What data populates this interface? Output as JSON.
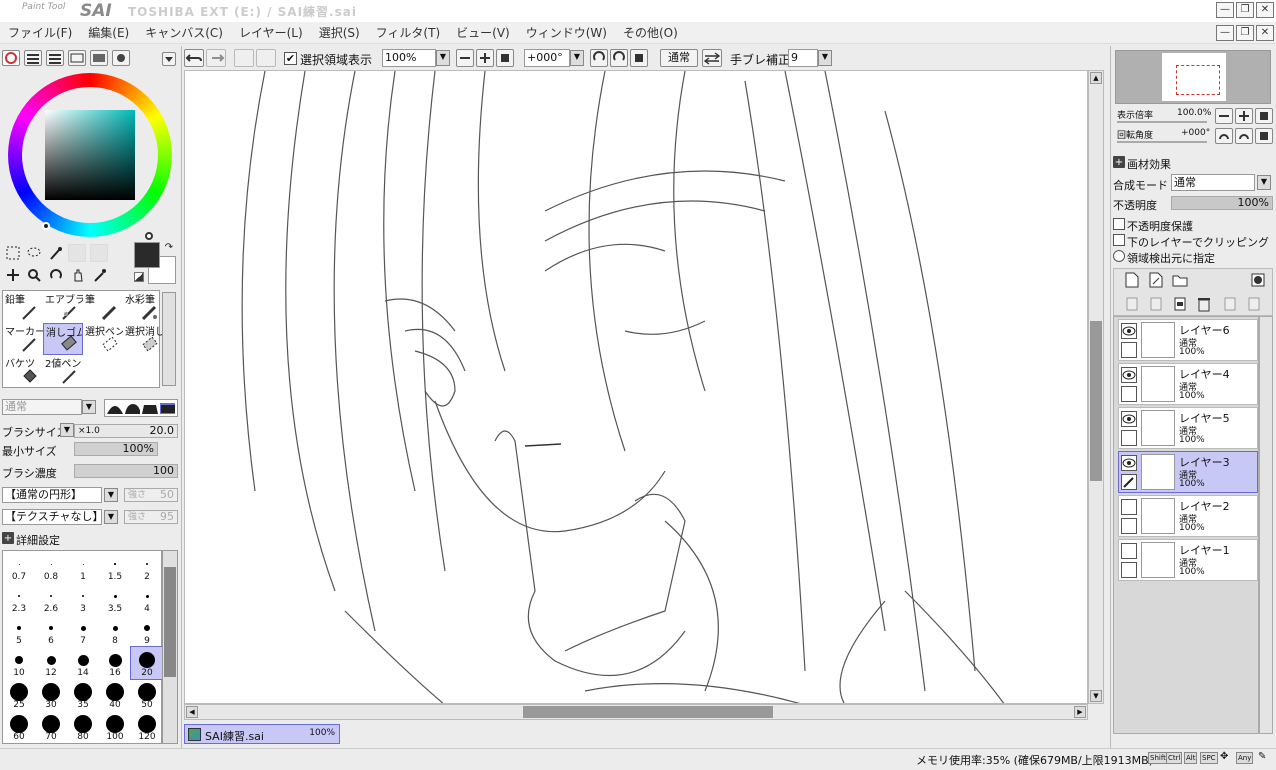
{
  "titlebar": {
    "app": "Paint Tool",
    "logo": "SAI",
    "title": "TOSHIBA EXT (E:) / SAI練習.sai",
    "btn_min": "—",
    "btn_max": "❐",
    "btn_close": "✕"
  },
  "menu": [
    "ファイル(F)",
    "編集(E)",
    "キャンバス(C)",
    "レイヤー(L)",
    "選択(S)",
    "フィルタ(T)",
    "ビュー(V)",
    "ウィンドウ(W)",
    "その他(O)"
  ],
  "toolbar": {
    "show_selection": "選択領域表示",
    "zoom": "100%",
    "angle": "+000°",
    "blend": "通常",
    "stabilizer_label": "手ブレ補正",
    "stabilizer": "9"
  },
  "tools": [
    {
      "name": "鉛筆"
    },
    {
      "name": "エアブラシ"
    },
    {
      "name": "筆"
    },
    {
      "name": "水彩筆"
    },
    {
      "name": "マーカー"
    },
    {
      "name": "消しゴム"
    },
    {
      "name": "選択ペン"
    },
    {
      "name": "選択消し"
    },
    {
      "name": "バケツ"
    },
    {
      "name": "2値ペン"
    }
  ],
  "brush": {
    "mode": "通常",
    "size_label": "ブラシサイズ",
    "size_mult": "×1.0",
    "size": "20.0",
    "min_label": "最小サイズ",
    "min": "100%",
    "density_label": "ブラシ濃度",
    "density": "100",
    "shape": "【通常の円形】",
    "shape_strength_label": "強さ",
    "shape_strength": "50",
    "texture": "【テクスチャなし】",
    "texture_strength_label": "強さ",
    "texture_strength": "95",
    "advanced": "詳細設定"
  },
  "sizes": [
    "0.7",
    "0.8",
    "1",
    "1.5",
    "2",
    "2.3",
    "2.6",
    "3",
    "3.5",
    "4",
    "5",
    "6",
    "7",
    "8",
    "9",
    "10",
    "12",
    "14",
    "16",
    "20",
    "25",
    "30",
    "35",
    "40",
    "50",
    "60",
    "70",
    "80",
    "100",
    "120"
  ],
  "navigator": {
    "zoom_label": "表示倍率",
    "zoom": "100.0%",
    "rot_label": "回転角度",
    "rot": "+000°"
  },
  "layer_panel": {
    "texture": "画材効果",
    "blend_label": "合成モード",
    "blend": "通常",
    "opacity_label": "不透明度",
    "opacity": "100%",
    "protect": "不透明度保護",
    "clip": "下のレイヤーでクリッピング",
    "source": "領域検出元に指定"
  },
  "layers": [
    {
      "name": "レイヤー6",
      "mode": "通常",
      "opacity": "100%"
    },
    {
      "name": "レイヤー4",
      "mode": "通常",
      "opacity": "100%"
    },
    {
      "name": "レイヤー5",
      "mode": "通常",
      "opacity": "100%"
    },
    {
      "name": "レイヤー3",
      "mode": "通常",
      "opacity": "100%"
    },
    {
      "name": "レイヤー2",
      "mode": "通常",
      "opacity": "100%"
    },
    {
      "name": "レイヤー1",
      "mode": "通常",
      "opacity": "100%"
    }
  ],
  "doc_tab": {
    "name": "SAI練習.sai",
    "zoom": "100%"
  },
  "status": {
    "memory": "メモリ使用率:35% (確保679MB/上限1913MB)",
    "keys": [
      "Shift",
      "Ctrl",
      "Alt",
      "SPC",
      "Any"
    ]
  },
  "colors": {
    "primary": "#2a2a2a",
    "secondary": "#ffffff",
    "accent": "#6a6ad8"
  }
}
